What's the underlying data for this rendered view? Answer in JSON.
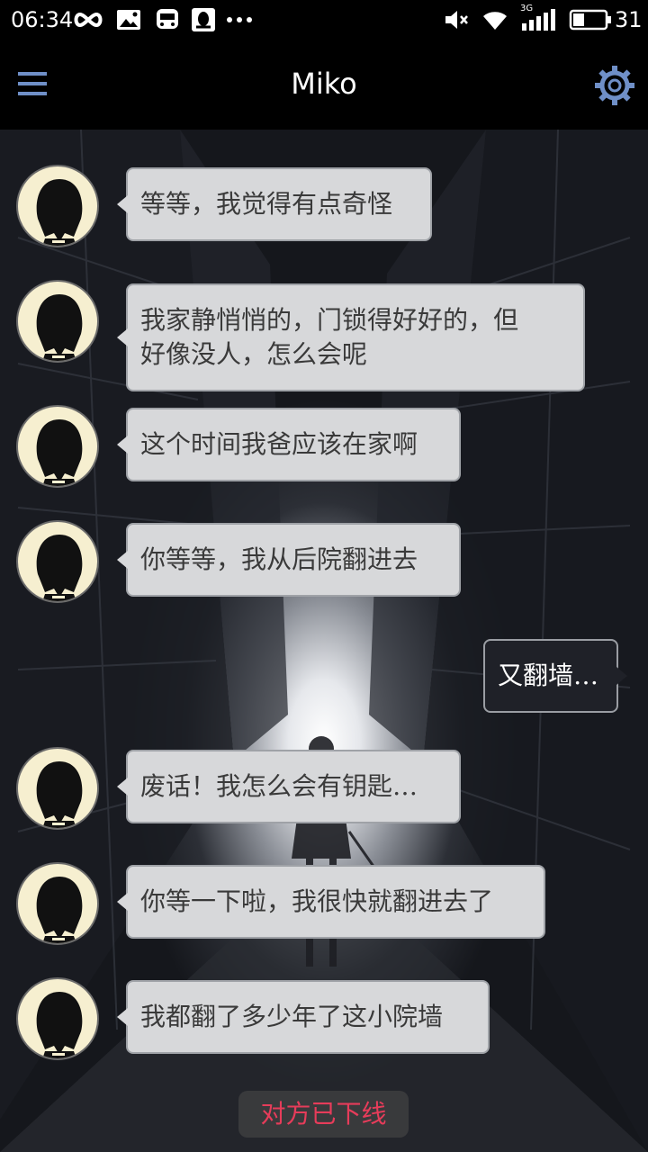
{
  "status_bar": {
    "time": "06:34",
    "battery_percent": "31",
    "network_label": "3G",
    "icons": [
      "infinity-icon",
      "photo-icon",
      "bus-icon",
      "qq-icon",
      "more-dots-icon",
      "mute-icon",
      "wifi-icon",
      "signal-icon",
      "battery-icon"
    ]
  },
  "header": {
    "title": "Miko",
    "menu_icon": "menu-icon",
    "settings_icon": "gear-icon"
  },
  "messages": [
    {
      "sender": "contact",
      "lines": [
        "等等，我觉得有点奇怪"
      ]
    },
    {
      "sender": "contact",
      "lines": [
        "我家静悄悄的，门锁得好好的，但",
        "好像没人，怎么会呢"
      ]
    },
    {
      "sender": "contact",
      "lines": [
        "这个时间我爸应该在家啊"
      ]
    },
    {
      "sender": "contact",
      "lines": [
        "你等等，我从后院翻进去"
      ]
    },
    {
      "sender": "me",
      "lines": [
        "又翻墙…"
      ]
    },
    {
      "sender": "contact",
      "lines": [
        "废话！我怎么会有钥匙…"
      ]
    },
    {
      "sender": "contact",
      "lines": [
        "你等一下啦，我很快就翻进去了"
      ]
    },
    {
      "sender": "contact",
      "lines": [
        "我都翻了多少年了这小院墙"
      ]
    }
  ],
  "footer": {
    "status": "对方已下线"
  },
  "colors": {
    "contact_bubble": "#d7d8da",
    "my_bubble": "#1f2128",
    "accent_icon": "#6f8fc7",
    "offline_text": "#e63c5a"
  }
}
